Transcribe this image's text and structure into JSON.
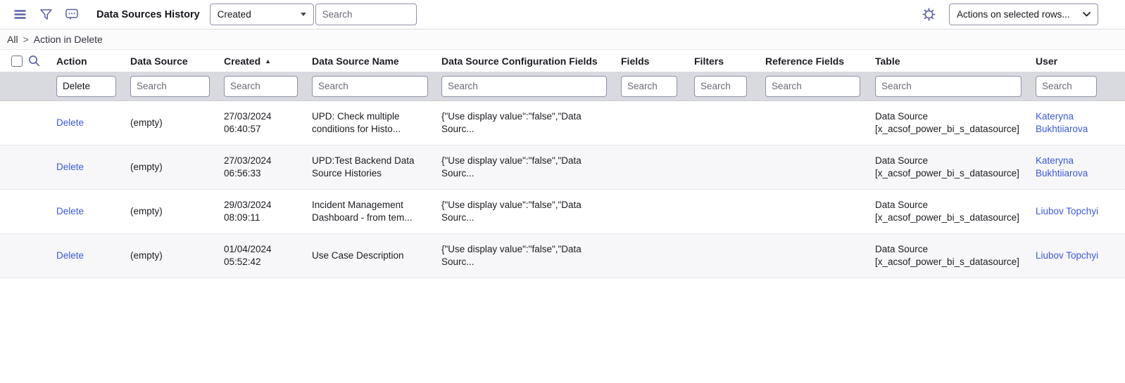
{
  "topbar": {
    "title": "Data Sources History",
    "menu_icon": "hamburger-menu",
    "filter_icon": "funnel",
    "chat_icon": "comment-bubble",
    "settings_icon": "gear",
    "sort_field_select": {
      "value": "Created"
    },
    "search_input": {
      "placeholder": "Search"
    },
    "actions_select": {
      "value": "Actions on selected rows..."
    }
  },
  "breadcrumb": {
    "root": "All",
    "separator": ">",
    "current": "Action in Delete"
  },
  "list": {
    "columns": [
      {
        "label": "Action",
        "filter": {
          "value": "Delete",
          "placeholder": ""
        }
      },
      {
        "label": "Data Source",
        "filter": {
          "placeholder": "Search"
        }
      },
      {
        "label": "Created",
        "sort_direction": "ascending",
        "sort_indicator": "▲",
        "filter": {
          "placeholder": "Search"
        }
      },
      {
        "label": "Data Source Name",
        "filter": {
          "placeholder": "Search"
        }
      },
      {
        "label": "Data Source Configuration Fields",
        "filter": {
          "placeholder": "Search"
        }
      },
      {
        "label": "Fields",
        "filter": {
          "placeholder": "Search"
        }
      },
      {
        "label": "Filters",
        "filter": {
          "placeholder": "Search"
        }
      },
      {
        "label": "Reference Fields",
        "filter": {
          "placeholder": "Search"
        }
      },
      {
        "label": "Table",
        "filter": {
          "placeholder": "Search"
        }
      },
      {
        "label": "User",
        "filter": {
          "placeholder": "Search"
        }
      }
    ],
    "rows": [
      {
        "action": "Delete",
        "data_source": "(empty)",
        "created": "27/03/2024 06:40:57",
        "data_source_name": "UPD: Check multiple conditions for Histo...",
        "config_fields": "{\"Use display value\":\"false\",\"Data Sourc...",
        "fields": "",
        "filters": "",
        "reference_fields": "",
        "table": "Data Source [x_acsof_power_bi_s_datasource]",
        "user": "Kateryna Bukhtiiarova"
      },
      {
        "action": "Delete",
        "data_source": "(empty)",
        "created": "27/03/2024 06:56:33",
        "data_source_name": "UPD:Test Backend Data Source Histories",
        "config_fields": "{\"Use display value\":\"false\",\"Data Sourc...",
        "fields": "",
        "filters": "",
        "reference_fields": "",
        "table": "Data Source [x_acsof_power_bi_s_datasource]",
        "user": "Kateryna Bukhtiiarova"
      },
      {
        "action": "Delete",
        "data_source": "(empty)",
        "created": "29/03/2024 08:09:11",
        "data_source_name": "Incident Management Dashboard - from tem...",
        "config_fields": "{\"Use display value\":\"false\",\"Data Sourc...",
        "fields": "",
        "filters": "",
        "reference_fields": "",
        "table": "Data Source [x_acsof_power_bi_s_datasource]",
        "user": "Liubov Topchyi"
      },
      {
        "action": "Delete",
        "data_source": "(empty)",
        "created": "01/04/2024 05:52:42",
        "data_source_name": "Use Case Description",
        "config_fields": "{\"Use display value\":\"false\",\"Data Sourc...",
        "fields": "",
        "filters": "",
        "reference_fields": "",
        "table": "Data Source [x_acsof_power_bi_s_datasource]",
        "user": "Liubov Topchyi"
      }
    ]
  }
}
